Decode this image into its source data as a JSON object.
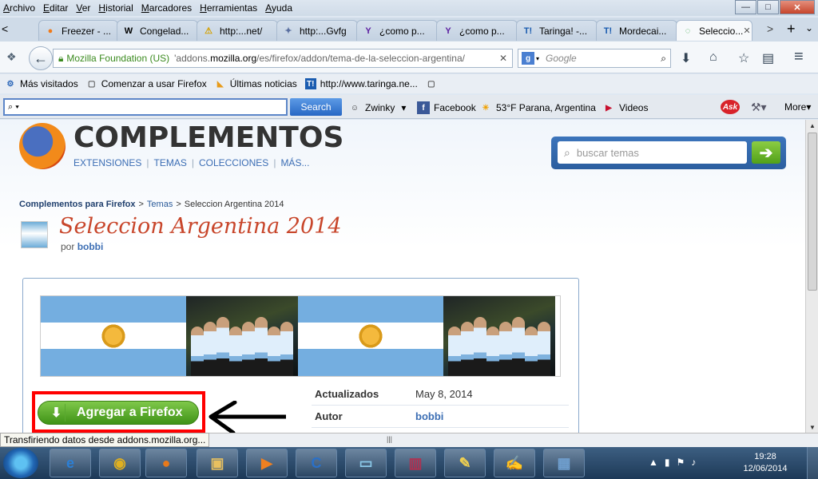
{
  "menu": [
    "Archivo",
    "Editar",
    "Ver",
    "Historial",
    "Marcadores",
    "Herramientas",
    "Ayuda"
  ],
  "window_controls": {
    "minimize": "—",
    "maximize": "□",
    "close": "✕"
  },
  "tabs": [
    {
      "label": "Freezer - ...",
      "icon": "●",
      "icon_color": "#f07a1a"
    },
    {
      "label": "Congelad...",
      "icon": "W",
      "icon_color": "#000000"
    },
    {
      "label": "http:...net/",
      "icon": "⚠",
      "icon_color": "#d4a000"
    },
    {
      "label": "http:...Gvfg",
      "icon": "✦",
      "icon_color": "#5a6fa0"
    },
    {
      "label": "¿como p...",
      "icon": "Y",
      "icon_color": "#5c1fa0"
    },
    {
      "label": "¿como p...",
      "icon": "Y",
      "icon_color": "#5c1fa0"
    },
    {
      "label": "Taringa! -...",
      "icon": "T!",
      "icon_color": "#1a5cb0"
    },
    {
      "label": "Mordecai...",
      "icon": "T!",
      "icon_color": "#1a5cb0"
    },
    {
      "label": "Seleccio...",
      "icon": "◌",
      "icon_color": "#3aa84a",
      "active": true
    }
  ],
  "tab_close": "✕",
  "tab_nav": {
    "left": "<",
    "right": ">",
    "new_tab": "+",
    "list": "⌄"
  },
  "urlbar": {
    "site_identity": "Mozilla Foundation (US)",
    "prefix": "'addons.",
    "host": "mozilla.org",
    "path": "/es/firefox/addon/tema-de-la-seleccion-argentina/",
    "clear": "✕"
  },
  "search_engine": {
    "placeholder": "Google",
    "icon": "g"
  },
  "nav_icons": {
    "back": "←",
    "download": "⬇",
    "home": "⌂",
    "star": "☆",
    "reader": "▤",
    "menu": "≡",
    "search": "⌕"
  },
  "bookmarks": [
    {
      "label": "Más visitados",
      "icon": "⚙"
    },
    {
      "label": "Comenzar a usar Firefox",
      "icon": "▢"
    },
    {
      "label": "Últimas noticias",
      "icon": "◣"
    },
    {
      "label": "http://www.taringa.ne...",
      "icon": "T!"
    },
    {
      "label": "",
      "icon": "▢"
    }
  ],
  "ask_toolbar": {
    "search_button": "Search",
    "input_icon": "⌕",
    "items": [
      {
        "label": "Zwinky",
        "icon": "☺"
      },
      {
        "label": "Facebook",
        "icon": "f"
      },
      {
        "label": "53°F Parana, Argentina",
        "icon": "☀"
      },
      {
        "label": "Videos",
        "icon": "▶"
      }
    ],
    "ask_logo": "Ask",
    "more": "More"
  },
  "page": {
    "site_title": "COMPLEMENTOS",
    "site_nav": [
      "EXTENSIONES",
      "TEMAS",
      "COLECCIONES",
      "MÁS..."
    ],
    "search_placeholder": "buscar temas",
    "search_go": "➔",
    "breadcrumb": [
      "Complementos para Firefox",
      "Temas",
      "Seleccion Argentina 2014"
    ],
    "theme_title": "Seleccion Argentina 2014",
    "author_prefix": "por",
    "author": "bobbi",
    "add_button": "Agregar a Firefox",
    "add_icon": "⬇",
    "meta": [
      {
        "key": "Actualizados",
        "value": "May 8, 2014"
      },
      {
        "key": "Autor",
        "value": "bobbi"
      }
    ]
  },
  "status_text": "Transfiriendo datos desde addons.mozilla.org...",
  "taskbar": {
    "apps": [
      {
        "name": "ie",
        "glyph": "e",
        "color": "#2b7fd6"
      },
      {
        "name": "chrome",
        "glyph": "◉",
        "color": "#e0b020"
      },
      {
        "name": "firefox",
        "glyph": "●",
        "color": "#e8791a"
      },
      {
        "name": "explorer",
        "glyph": "▣",
        "color": "#e8c060"
      },
      {
        "name": "media",
        "glyph": "▶",
        "color": "#f08020"
      },
      {
        "name": "ccleaner",
        "glyph": "C",
        "color": "#2a70c8"
      },
      {
        "name": "notes",
        "glyph": "▭",
        "color": "#8ac8e8"
      },
      {
        "name": "winrar",
        "glyph": "▥",
        "color": "#b03050"
      },
      {
        "name": "paint",
        "glyph": "✎",
        "color": "#f0d050"
      },
      {
        "name": "editor",
        "glyph": "✍",
        "color": "#90a8d0"
      },
      {
        "name": "control",
        "glyph": "▦",
        "color": "#70a0d0"
      }
    ],
    "time": "19:28",
    "date": "12/06/2014",
    "tray_icons": [
      "▲",
      "▮",
      "⚑",
      "♪"
    ]
  }
}
